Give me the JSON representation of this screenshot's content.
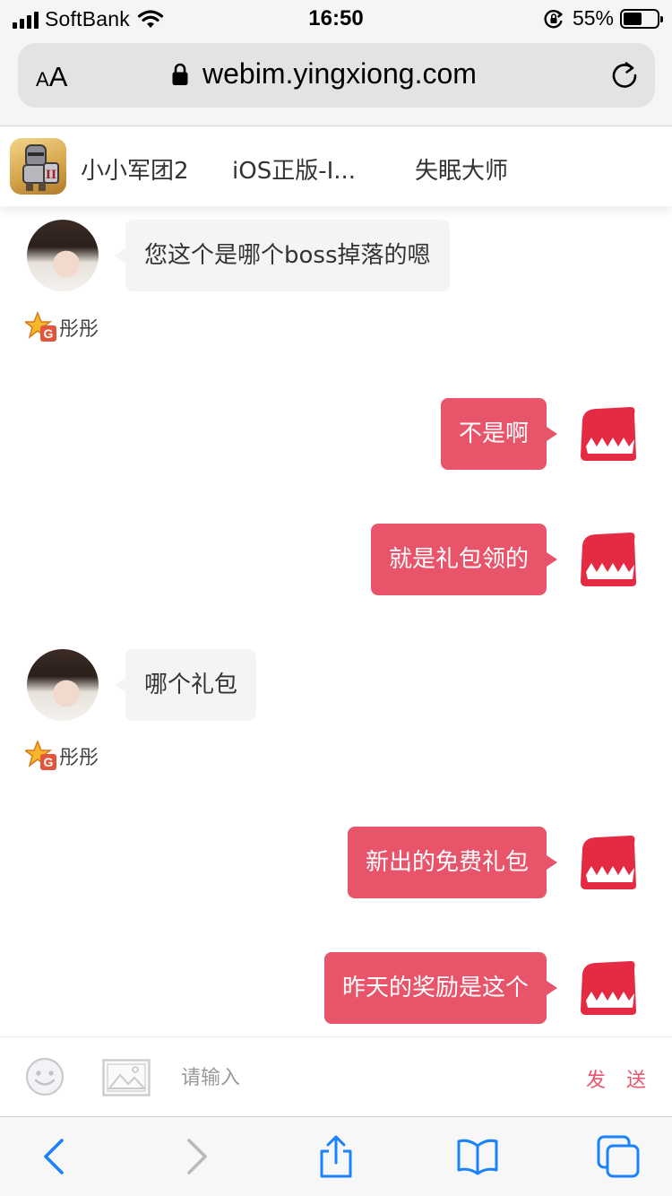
{
  "status_bar": {
    "carrier": "SoftBank",
    "time": "16:50",
    "battery_percent": "55%",
    "battery_level": 0.55,
    "icons": [
      "signal-icon",
      "wifi-icon",
      "orientation-lock-icon",
      "battery-icon"
    ]
  },
  "safari": {
    "text_size_small": "A",
    "text_size_big": "A",
    "url": "webim.yingxiong.com",
    "icons": [
      "padlock-icon",
      "reload-icon"
    ]
  },
  "game_tabs": [
    {
      "label": "小小军团2"
    },
    {
      "label": "iOS正版-I..."
    },
    {
      "label": "失眠大师"
    }
  ],
  "messages": [
    {
      "side": "left",
      "text": "您这个是哪个boss掉落的嗯",
      "sender": "彤彤"
    },
    {
      "side": "right",
      "text": "不是啊"
    },
    {
      "side": "right",
      "text": "就是礼包领的"
    },
    {
      "side": "left",
      "text": "哪个礼包",
      "sender": "彤彤"
    },
    {
      "side": "right",
      "text": "新出的免费礼包"
    },
    {
      "side": "right",
      "text": "昨天的奖励是这个"
    }
  ],
  "input_bar": {
    "placeholder": "请输入",
    "send_label": "发 送",
    "icons": [
      "emoji-icon",
      "image-icon"
    ]
  },
  "colors": {
    "accent": "#e8546a",
    "bubble_left": "#f4f4f4",
    "ios_blue": "#1a82fb"
  },
  "toolbar": {
    "icons": [
      "back-icon",
      "forward-icon",
      "share-icon",
      "bookmarks-icon",
      "tabs-icon"
    ]
  }
}
